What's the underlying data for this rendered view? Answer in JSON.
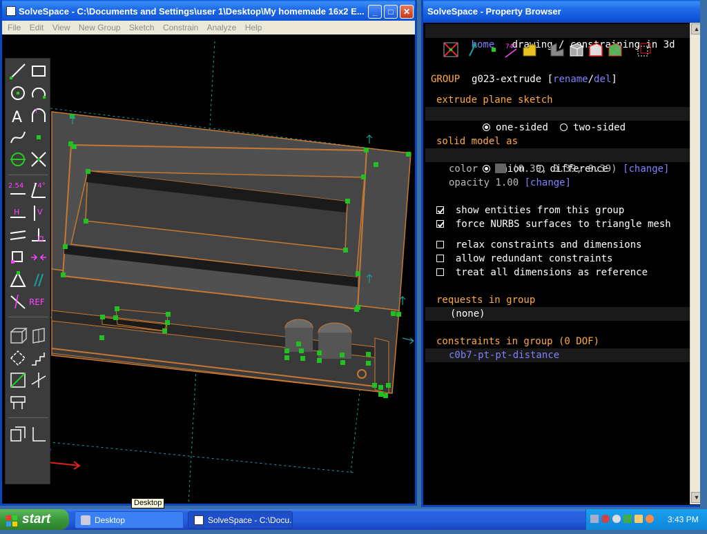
{
  "main_window": {
    "title": "SolveSpace - C:\\Documents and Settings\\user 1\\Desktop\\My homemade 16x2 E...",
    "menu": [
      "File",
      "Edit",
      "View",
      "New Group",
      "Sketch",
      "Constrain",
      "Analyze",
      "Help"
    ]
  },
  "toolbar": {
    "dimension_label": "2.54",
    "angle_label": "74°",
    "h_label": "H",
    "v_label": "V",
    "ref_label": "REF"
  },
  "property_window": {
    "title": "SolveSpace - Property Browser",
    "nav_home": "home",
    "nav_mode": "drawing / constraining in 3d",
    "group_label": "GROUP",
    "group_name": "g023-extrude",
    "rename": "rename",
    "del": "del",
    "extrude_header": "extrude plane sketch",
    "one_sided": "one-sided",
    "two_sided": "two-sided",
    "solid_header": "solid model as",
    "union": "union",
    "difference": "difference",
    "color_label": "color",
    "color_value": "(0.39, 0.39, 0.39)",
    "change": "[change]",
    "opacity_label": "opacity",
    "opacity_value": "1.00",
    "show_entities": "show entities from this group",
    "force_nurbs": "force NURBS surfaces to triangle mesh",
    "relax": "relax constraints and dimensions",
    "allow_redundant": "allow redundant constraints",
    "treat_ref": "treat all dimensions as reference",
    "requests_header": "requests in group",
    "requests_none": "(none)",
    "constraints_header": "constraints in group (0 DOF)",
    "constraint_item": "c0b7-pt-pt-distance",
    "angle_icon_label": "74°"
  },
  "taskbar": {
    "start": "start",
    "task_desktop": "Desktop",
    "task_solvespace": "SolveSpace - C:\\Docu...",
    "clock": "3:43 PM",
    "tooltip": "Desktop"
  },
  "colors": {
    "accent_orange": "#ffaa40",
    "link_blue": "#8080ff",
    "model_gray": "#636363",
    "point_green": "#22c022",
    "edge_orange": "#c87830"
  }
}
